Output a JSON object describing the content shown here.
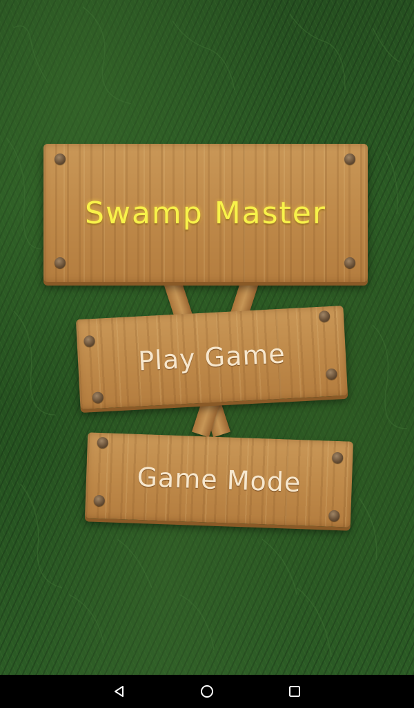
{
  "game": {
    "title": "Swamp Master",
    "menu": {
      "play_label": "Play Game",
      "mode_label": "Game Mode"
    }
  },
  "navbar": {
    "back_icon": "back-triangle-icon",
    "home_icon": "home-circle-icon",
    "recents_icon": "recents-square-icon"
  },
  "colors": {
    "title_text": "#f8f24a",
    "button_text": "#f7e7cd",
    "wood": "#c08b4b",
    "grass": "#254f20"
  }
}
